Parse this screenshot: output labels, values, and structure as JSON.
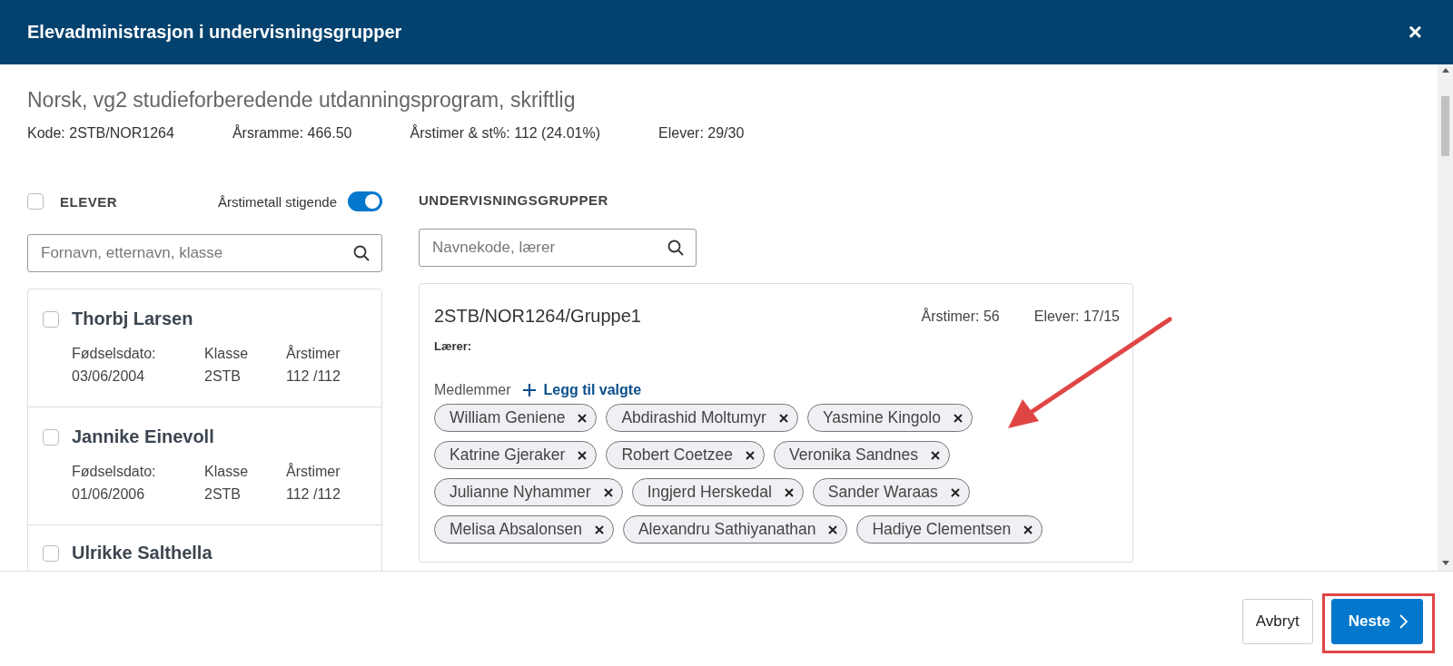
{
  "dialog": {
    "title": "Elevadministrasjon i undervisningsgrupper",
    "close_label": "×"
  },
  "course": {
    "name": "Norsk, vg2 studieforberedende utdanningsprogram, skriftlig",
    "stats": [
      "Kode: 2STB/NOR1264",
      "Årsramme: 466.50",
      "Årstimer & st%: 112 (24.01%)",
      "Elever: 29/30"
    ]
  },
  "students": {
    "select_all": {
      "label": "ELEVER",
      "checked": false
    },
    "sort_toggle": {
      "label": "Årstimetall stigende",
      "on": true
    },
    "search": {
      "placeholder": "Fornavn, etternavn, klasse"
    },
    "items": [
      {
        "name": "Thorbj Larsen",
        "checked": false,
        "fields": [
          {
            "label": "Fødselsdato:",
            "value": "03/06/2004"
          },
          {
            "label": "Klasse",
            "value": "2STB"
          },
          {
            "label": "Årstimer",
            "value": "112 /112"
          }
        ]
      },
      {
        "name": "Jannike Einevoll",
        "checked": false,
        "fields": [
          {
            "label": "Fødselsdato:",
            "value": "01/06/2006"
          },
          {
            "label": "Klasse",
            "value": "2STB"
          },
          {
            "label": "Årstimer",
            "value": "112 /112"
          }
        ]
      },
      {
        "name": "Ulrikke Salthella",
        "checked": false
      }
    ]
  },
  "groups": {
    "heading": "UNDERVISNINGSGRUPPER",
    "search": {
      "placeholder": "Navnekode, lærer"
    },
    "items": [
      {
        "name": "2STB/NOR1264/Gruppe1",
        "hours": "Årstimer: 56",
        "students": "Elever: 17/15",
        "teacher_label": "Lærer:",
        "members_label": "Medlemmer",
        "add_label": "Legg til valgte",
        "members": [
          "William Geniene",
          "Abdirashid Moltumyr",
          "Yasmine Kingolo",
          "Katrine Gjeraker",
          "Robert Coetzee",
          "Veronika Sandnes",
          "Julianne Nyhammer",
          "Ingjerd Herskedal",
          "Sander Waraas",
          "Melisa Absalonsen",
          "Alexandru Sathiyanathan",
          "Hadiye Clementsen"
        ]
      }
    ]
  },
  "footer": {
    "buttons": [
      {
        "label": "Avbryt",
        "kind": "secondary"
      },
      {
        "label": "Neste",
        "kind": "primary"
      }
    ]
  }
}
